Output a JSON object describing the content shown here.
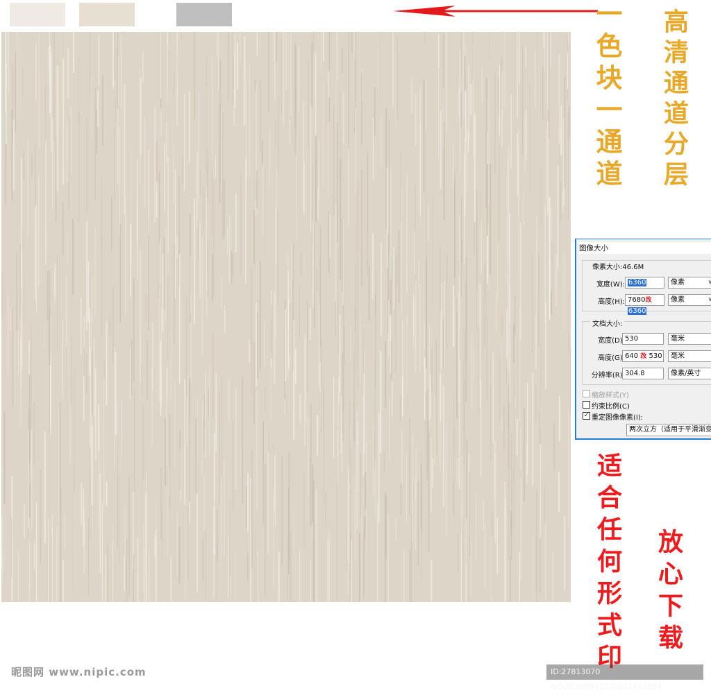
{
  "swatches": [
    {
      "name": "swatch-light",
      "color": "#efeae3"
    },
    {
      "name": "swatch-beige",
      "color": "#e7dfd2"
    },
    {
      "name": "swatch-gray",
      "color": "#bfbfbf"
    }
  ],
  "arrow_icon": "left-arrow",
  "texture_colors": {
    "base": "#ddd5c8",
    "light": "#f3efe7",
    "dark": "#c9bfb0"
  },
  "annotations": {
    "one_block_one_channel": "一色块一通道",
    "hd_channel_layers": "高清通道分层",
    "fits_any_print": "适合任何形式印",
    "download_freely": "放心下载"
  },
  "dialog": {
    "title": "图像大小",
    "pixel_dimensions_label": "像素大小:46.6M",
    "width_label": "宽度(W):",
    "width_value": "6360",
    "width_unit": "像素",
    "height_label": "高度(H):",
    "height_value_old": "7680",
    "height_change_mark": "改",
    "height_value_new": "6360",
    "height_unit": "像素",
    "doc_size_label": "文档大小:",
    "doc_width_label": "宽度(D):",
    "doc_width_value": "530",
    "doc_width_unit": "毫米",
    "doc_height_label": "高度(G):",
    "doc_height_value_old": "640",
    "doc_height_change_mark": "改",
    "doc_height_value_new": "530",
    "doc_height_unit": "毫米",
    "resolution_label": "分辨率(R):",
    "resolution_value": "304.8",
    "resolution_unit": "像素/英寸",
    "scale_styles_label": "缩放样式(Y)",
    "constrain_label": "约束比例(C)",
    "resample_label": "重定图像像素(I):",
    "resample_method": "两次立方（适用于平滑渐变"
  },
  "watermark": {
    "site": "昵图网 www.nipic.com",
    "id_text": "ID:27813070 NO:20200911170811461087"
  }
}
